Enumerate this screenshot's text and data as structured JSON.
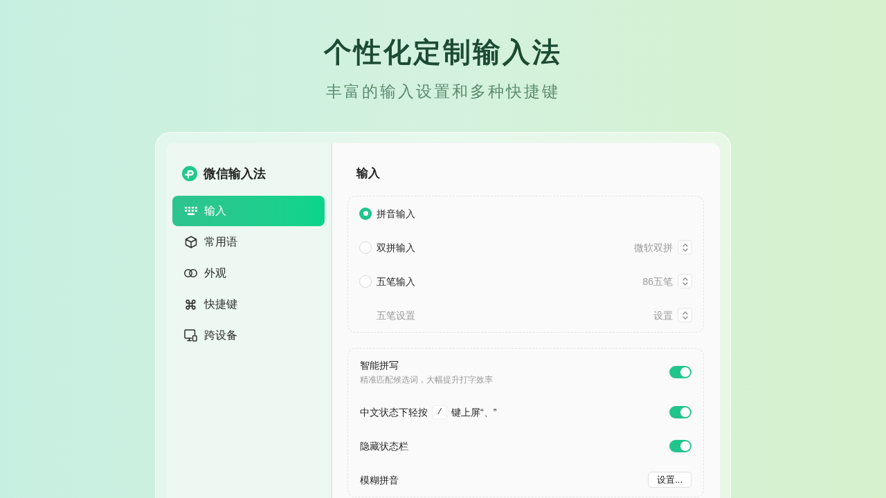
{
  "hero": {
    "title": "个性化定制输入法",
    "subtitle": "丰富的输入设置和多种快捷键"
  },
  "sidebar": {
    "app_name": "微信输入法",
    "items": [
      {
        "label": "输入",
        "selected": true
      },
      {
        "label": "常用语",
        "selected": false
      },
      {
        "label": "外观",
        "selected": false
      },
      {
        "label": "快捷键",
        "selected": false
      },
      {
        "label": "跨设备",
        "selected": false
      }
    ]
  },
  "input": {
    "title": "输入",
    "methods": [
      {
        "label": "拼音输入",
        "selected": true
      },
      {
        "label": "双拼输入",
        "selected": false,
        "value": "微软双拼"
      },
      {
        "label": "五笔输入",
        "selected": false,
        "value": "86五笔"
      }
    ],
    "wubi_settings": {
      "label": "五笔设置",
      "value": "设置",
      "disabled": true
    }
  },
  "settings": [
    {
      "kind": "toggle",
      "label": "智能拼写",
      "description": "精准匹配候选词，大幅提升打字效率",
      "on": true
    },
    {
      "kind": "toggle",
      "label": "中文状态下轻按",
      "key": "/",
      "label_after": "键上屏“、”",
      "on": true
    },
    {
      "kind": "toggle",
      "label": "隐藏状态栏",
      "on": true
    },
    {
      "kind": "button",
      "label": "模糊拼音",
      "button": "设置..."
    }
  ]
}
